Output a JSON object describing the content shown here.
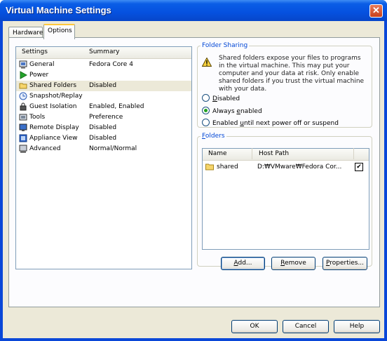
{
  "window": {
    "title": "Virtual Machine Settings",
    "close_glyph": "✕"
  },
  "tabs": [
    {
      "label": "Hardware",
      "active": false
    },
    {
      "label": "Options",
      "active": true
    }
  ],
  "settings_list": {
    "headers": {
      "settings": "Settings",
      "summary": "Summary"
    },
    "items": [
      {
        "name": "General",
        "summary": "Fedora Core 4",
        "icon": "general-icon"
      },
      {
        "name": "Power",
        "summary": "",
        "icon": "power-icon"
      },
      {
        "name": "Shared Folders",
        "summary": "Disabled",
        "icon": "folder-icon",
        "selected": true
      },
      {
        "name": "Snapshot/Replay",
        "summary": "",
        "icon": "snapshot-icon"
      },
      {
        "name": "Guest Isolation",
        "summary": "Enabled, Enabled",
        "icon": "lock-icon"
      },
      {
        "name": "Tools",
        "summary": "Preference",
        "icon": "tools-icon"
      },
      {
        "name": "Remote Display",
        "summary": "Disabled",
        "icon": "monitor-icon"
      },
      {
        "name": "Appliance View",
        "summary": "Disabled",
        "icon": "appliance-icon"
      },
      {
        "name": "Advanced",
        "summary": "Normal/Normal",
        "icon": "advanced-icon"
      }
    ]
  },
  "folder_sharing": {
    "legend": "Folder Sharing",
    "warning": "Shared folders expose your files to programs in the virtual machine. This may put your computer and your data at risk. Only enable shared folders if you trust the virtual machine with your data.",
    "options": [
      {
        "pre": "",
        "u": "D",
        "post": "isabled",
        "checked": false
      },
      {
        "pre": "Always ",
        "u": "e",
        "post": "nabled",
        "checked": true
      },
      {
        "pre": "Enabled ",
        "u": "u",
        "post": "ntil next power off or suspend",
        "checked": false
      }
    ]
  },
  "folders": {
    "legend_u": "F",
    "legend_rest": "olders",
    "headers": {
      "name": "Name",
      "host_path": "Host Path"
    },
    "rows": [
      {
        "name": "shared",
        "host_path": "D:₩VMware₩Fedora Cor...",
        "enabled": true
      }
    ],
    "buttons": {
      "add": {
        "u": "A",
        "rest": "dd..."
      },
      "remove": {
        "u": "R",
        "rest": "emove"
      },
      "properties": {
        "u": "P",
        "rest": "roperties..."
      }
    }
  },
  "footer": {
    "ok": "OK",
    "cancel": "Cancel",
    "help": "Help"
  },
  "colors": {
    "titlebar": "#0551df",
    "legend": "#0046d5",
    "selection": "#ece9d8"
  }
}
